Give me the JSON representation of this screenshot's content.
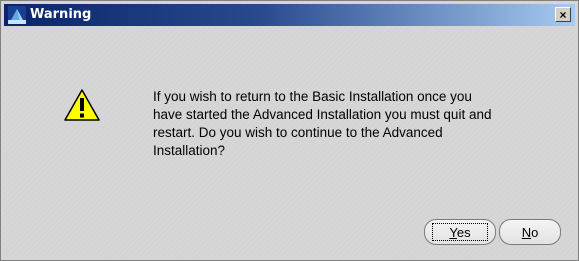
{
  "window": {
    "title": "Warning",
    "close_label": "×"
  },
  "message": {
    "text": "If you wish to return to the Basic Installation once you\nhave started the Advanced Installation you must quit and\nrestart. Do you wish to continue to the Advanced\nInstallation?"
  },
  "icon": {
    "title_icon": "installer-app-icon",
    "message_icon": "warning-triangle-icon"
  },
  "buttons": {
    "yes_mnemonic": "Y",
    "yes_rest": "es",
    "no_mnemonic": "N",
    "no_rest": "o"
  },
  "colors": {
    "titlebar_start": "#0a246a",
    "titlebar_end": "#a6caf0",
    "dialog_bg": "#d4d4d4",
    "warning_yellow": "#ffff00"
  }
}
